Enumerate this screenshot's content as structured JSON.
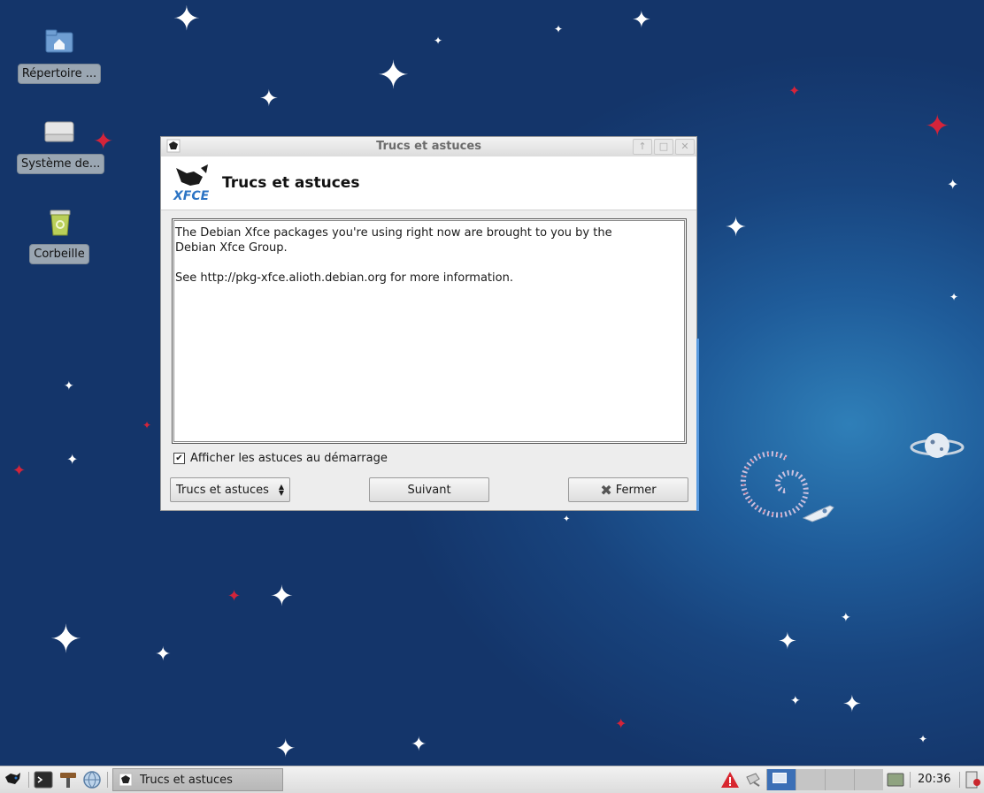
{
  "desktop": {
    "icons": [
      {
        "label": "Répertoire ...",
        "icon": "home-folder-icon"
      },
      {
        "label": "Système de...",
        "icon": "drive-icon"
      },
      {
        "label": "Corbeille",
        "icon": "trash-icon"
      }
    ]
  },
  "dialog": {
    "window_title": "Trucs et astuces",
    "header_title": "Trucs et astuces",
    "body_text": "The Debian Xfce packages you're using right now are brought to you by the\nDebian Xfce Group.\n\nSee http://pkg-xfce.alioth.debian.org for more information.",
    "checkbox_label": "Afficher les astuces au démarrage",
    "checkbox_checked": true,
    "combo_value": "Trucs et astuces",
    "next_button": "Suivant",
    "close_button": "Fermer",
    "logo_text": "XFCE"
  },
  "taskbar": {
    "task_label": "Trucs et astuces",
    "clock": "20:36",
    "launchers": [
      "xfce-menu-icon",
      "terminal-icon",
      "settings-brush-icon",
      "web-browser-icon"
    ],
    "tray": [
      "warning-icon",
      "network-icon"
    ]
  },
  "colors": {
    "desktop_dark": "#14356a",
    "desktop_light": "#2f7fb8",
    "active_workspace": "#3b6fb6"
  }
}
